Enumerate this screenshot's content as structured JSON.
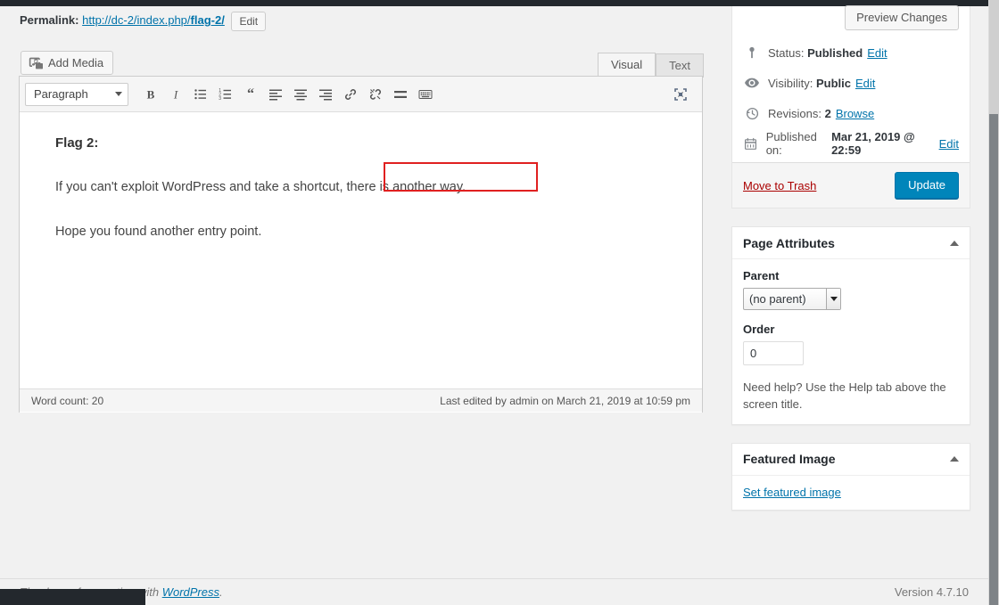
{
  "permalink": {
    "label": "Permalink:",
    "url_prefix": "http://dc-2/index.php/",
    "url_slug": "flag-2/",
    "edit_button": "Edit"
  },
  "toolbar": {
    "add_media": "Add Media",
    "add_media_icon": "media-camera-music-icon",
    "format_select": "Paragraph",
    "buttons": [
      {
        "name": "bold-icon",
        "label": "B"
      },
      {
        "name": "italic-icon",
        "label": "I"
      },
      {
        "name": "bulleted-list-icon",
        "label": "Bulleted list"
      },
      {
        "name": "numbered-list-icon",
        "label": "Numbered list"
      },
      {
        "name": "blockquote-icon",
        "label": "Blockquote"
      },
      {
        "name": "align-left-icon",
        "label": "Align left"
      },
      {
        "name": "align-center-icon",
        "label": "Align center"
      },
      {
        "name": "align-right-icon",
        "label": "Align right"
      },
      {
        "name": "link-icon",
        "label": "Insert/edit link"
      },
      {
        "name": "unlink-icon",
        "label": "Remove link"
      },
      {
        "name": "read-more-icon",
        "label": "Insert Read More tag"
      },
      {
        "name": "toolbar-toggle-icon",
        "label": "Toolbar Toggle"
      }
    ],
    "fullscreen_icon": "distraction-free-writing-icon"
  },
  "editor_tabs": {
    "visual": "Visual",
    "text": "Text",
    "active": "Visual"
  },
  "content": {
    "heading": "Flag 2:",
    "paragraph1_before": "If you can't exploit WordPress and take a shortcut",
    "paragraph1_highlight": ", there is another way.",
    "paragraph1_full": "If you can't exploit WordPress and take a shortcut, there is another way.",
    "paragraph2": "Hope you found another entry point.",
    "annotation_color": "#e02020"
  },
  "status_bar": {
    "word_count": "Word count: 20",
    "last_edited": "Last edited by admin on March 21, 2019 at 10:59 pm"
  },
  "publish_box": {
    "preview_button": "Preview Changes",
    "rows": [
      {
        "icon": "pin-icon",
        "label": "Status:",
        "value": "Published",
        "action": "Edit"
      },
      {
        "icon": "eye-icon",
        "label": "Visibility:",
        "value": "Public",
        "action": "Edit"
      },
      {
        "icon": "clock-revisions-icon",
        "label": "Revisions:",
        "value": "2",
        "action": "Browse"
      },
      {
        "icon": "calendar-icon",
        "label": "Published on:",
        "value": "Mar 21, 2019 @ 22:59",
        "action": "Edit"
      }
    ],
    "trash_link": "Move to Trash",
    "update_button": "Update",
    "update_color": "#0085ba"
  },
  "page_attributes": {
    "title": "Page Attributes",
    "parent_label": "Parent",
    "parent_value": "(no parent)",
    "order_label": "Order",
    "order_value": "0",
    "help_text": "Need help? Use the Help tab above the screen title."
  },
  "featured_image": {
    "title": "Featured Image",
    "set_link": "Set featured image"
  },
  "footer": {
    "thanks_prefix": "Thank you for creating with ",
    "wordpress_link": "WordPress",
    "thanks_suffix": ".",
    "version": "Version 4.7.10"
  }
}
